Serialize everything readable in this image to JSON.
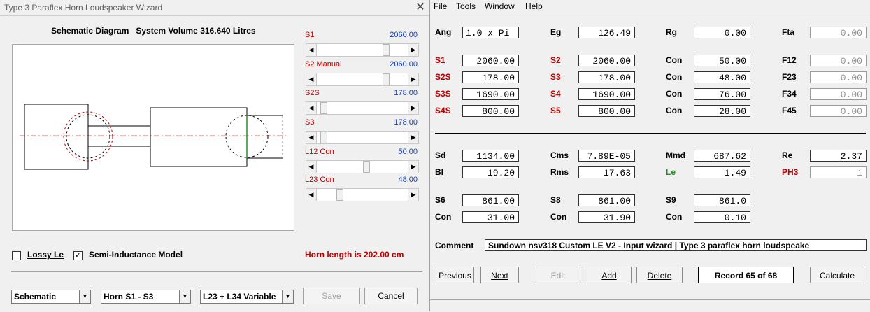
{
  "wizard": {
    "title": "Type 3 Paraflex Horn Loudspeaker Wizard",
    "close_glyph": "✕",
    "schematic_heading": "Schematic Diagram   System Volume 316.640 Litres",
    "sliders": [
      {
        "label": "S1",
        "value": "2060.00",
        "fraction": 0.78
      },
      {
        "label": "S2 Manual",
        "value": "2060.00",
        "fraction": 0.78
      },
      {
        "label": "S2S",
        "value": "178.00",
        "fraction": 0.05
      },
      {
        "label": "S3",
        "value": "178.00",
        "fraction": 0.05
      },
      {
        "label": "L12  Con",
        "value": "50.00",
        "fraction": 0.55
      },
      {
        "label": "L23  Con",
        "value": "48.00",
        "fraction": 0.24
      }
    ],
    "lossy_le": {
      "label": "Lossy Le",
      "checked": false
    },
    "semi_inductance": {
      "label": "Semi-Inductance Model",
      "checked": true
    },
    "horn_length": "Horn length is 202.00 cm",
    "combo_view": "Schematic",
    "combo_horn": "Horn S1 - S3",
    "combo_variable": "L23 + L34 Variable",
    "save_label": "Save",
    "cancel_label": "Cancel"
  },
  "menu": [
    "File",
    "Tools",
    "Window",
    "Help"
  ],
  "params": {
    "ang": {
      "label": "Ang",
      "value": "1.0 x Pi"
    },
    "eg": {
      "label": "Eg",
      "value": "126.49"
    },
    "rg": {
      "label": "Rg",
      "value": "0.00"
    },
    "fta": {
      "label": "Fta",
      "value": "0.00"
    },
    "s1": {
      "label": "S1",
      "value": "2060.00"
    },
    "s2": {
      "label": "S2",
      "value": "2060.00"
    },
    "con1": {
      "label": "Con",
      "value": "50.00"
    },
    "f12": {
      "label": "F12",
      "value": "0.00"
    },
    "s2s": {
      "label": "S2S",
      "value": "178.00"
    },
    "s3": {
      "label": "S3",
      "value": "178.00"
    },
    "con2": {
      "label": "Con",
      "value": "48.00"
    },
    "f23": {
      "label": "F23",
      "value": "0.00"
    },
    "s3s": {
      "label": "S3S",
      "value": "1690.00"
    },
    "s4": {
      "label": "S4",
      "value": "1690.00"
    },
    "con3": {
      "label": "Con",
      "value": "76.00"
    },
    "f34": {
      "label": "F34",
      "value": "0.00"
    },
    "s4s": {
      "label": "S4S",
      "value": "800.00"
    },
    "s5": {
      "label": "S5",
      "value": "800.00"
    },
    "con4": {
      "label": "Con",
      "value": "28.00"
    },
    "f45": {
      "label": "F45",
      "value": "0.00"
    },
    "sd": {
      "label": "Sd",
      "value": "1134.00"
    },
    "cms": {
      "label": "Cms",
      "value": "7.89E-05"
    },
    "mmd": {
      "label": "Mmd",
      "value": "687.62"
    },
    "re": {
      "label": "Re",
      "value": "2.37"
    },
    "bl": {
      "label": "Bl",
      "value": "19.20"
    },
    "rms": {
      "label": "Rms",
      "value": "17.63"
    },
    "le": {
      "label": "Le",
      "value": "1.49"
    },
    "ph3": {
      "label": "PH3",
      "value": "1"
    },
    "s6": {
      "label": "S6",
      "value": "861.00"
    },
    "s8": {
      "label": "S8",
      "value": "861.00"
    },
    "s9": {
      "label": "S9",
      "value": "861.0"
    },
    "con5": {
      "label": "Con",
      "value": "31.00"
    },
    "con6": {
      "label": "Con",
      "value": "31.90"
    },
    "con7": {
      "label": "Con",
      "value": "0.10"
    }
  },
  "comment": {
    "label": "Comment",
    "value": "Sundown nsv318 Custom LE V2 - Input wizard | Type 3 paraflex horn loudspeake"
  },
  "buttons": {
    "previous": "Previous",
    "next": "Next",
    "edit": "Edit",
    "add": "Add",
    "delete": "Delete",
    "record": "Record 65 of 68",
    "calculate": "Calculate"
  }
}
